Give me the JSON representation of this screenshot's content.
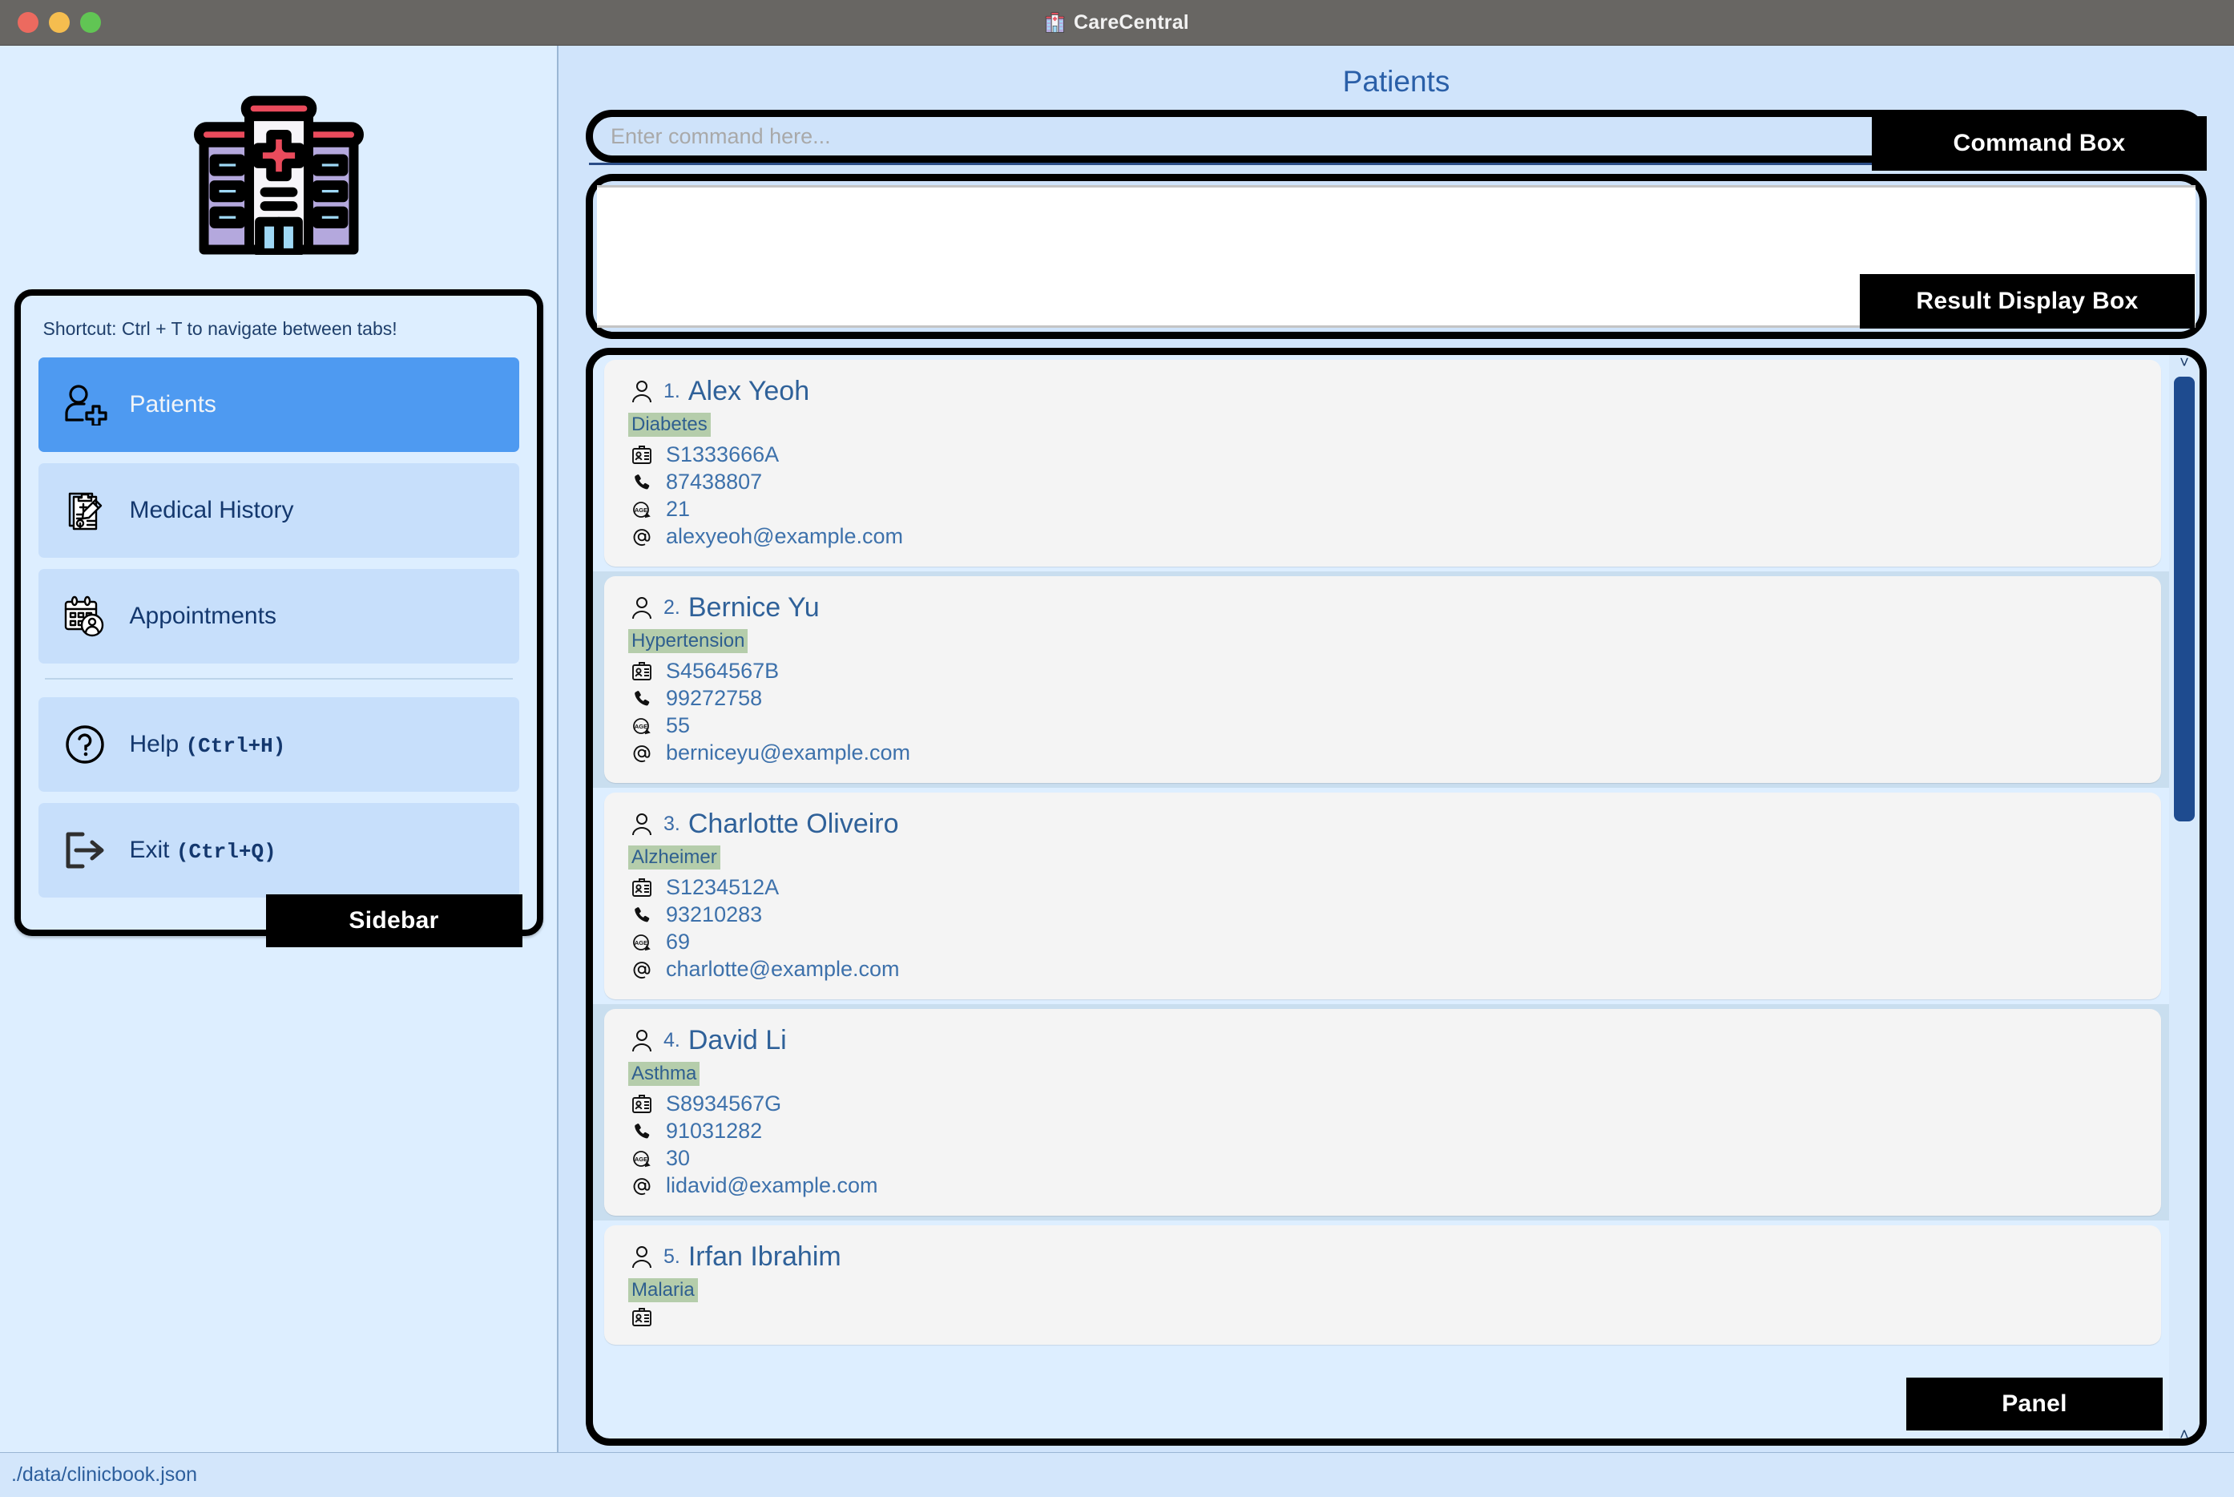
{
  "window": {
    "title": "CareCentral",
    "traffic_lights": [
      "close-red",
      "minimize-yellow",
      "maximize-green"
    ]
  },
  "sidebar": {
    "logo_icon": "hospital-building-icon",
    "shortcut_hint": "Shortcut: Ctrl + T to navigate between tabs!",
    "tag_label": "Sidebar",
    "items": [
      {
        "label": "Patients",
        "icon": "person-add-icon",
        "active": true,
        "shortcut": ""
      },
      {
        "label": "Medical History",
        "icon": "clipboard-pencil-icon",
        "active": false,
        "shortcut": ""
      },
      {
        "label": "Appointments",
        "icon": "calendar-person-icon",
        "active": false,
        "shortcut": ""
      }
    ],
    "utility_items": [
      {
        "label": "Help",
        "icon": "question-circle-icon",
        "shortcut": "(Ctrl+H)"
      },
      {
        "label": "Exit",
        "icon": "exit-arrow-icon",
        "shortcut": "(Ctrl+Q)"
      }
    ]
  },
  "main": {
    "page_title": "Patients",
    "command_tag_label": "Command Box",
    "result_tag_label": "Result Display Box",
    "panel_tag_label": "Panel",
    "command_input": {
      "value": "",
      "placeholder": "Enter command here..."
    },
    "result_display": {
      "text": ""
    },
    "scrollbar": {
      "up_arrow": "chevron-up-icon",
      "down_arrow": "chevron-down-icon",
      "thumb_position": "top"
    }
  },
  "patients": [
    {
      "index": "1.",
      "name": "Alex Yeoh",
      "tag": "Diabetes",
      "nric": "S1333666A",
      "phone": "87438807",
      "age": "21",
      "email": "alexyeoh@example.com"
    },
    {
      "index": "2.",
      "name": "Bernice Yu",
      "tag": "Hypertension",
      "nric": "S4564567B",
      "phone": "99272758",
      "age": "55",
      "email": "berniceyu@example.com"
    },
    {
      "index": "3.",
      "name": "Charlotte Oliveiro",
      "tag": "Alzheimer",
      "nric": "S1234512A",
      "phone": "93210283",
      "age": "69",
      "email": "charlotte@example.com"
    },
    {
      "index": "4.",
      "name": "David Li",
      "tag": "Asthma",
      "nric": "S8934567G",
      "phone": "91031282",
      "age": "30",
      "email": "lidavid@example.com"
    },
    {
      "index": "5.",
      "name": "Irfan Ibrahim",
      "tag": "Malaria",
      "nric": "",
      "phone": "",
      "age": "",
      "email": ""
    }
  ],
  "statusbar": {
    "file_path": "./data/clinicbook.json"
  },
  "colors": {
    "accent_blue": "#4e9af1",
    "sidebar_bg": "#ddeeff",
    "main_bg": "#d0e4fb",
    "tag_bg": "#000000",
    "tag_fg": "#ffffff",
    "condition_highlight": "#b5cdab",
    "scrollbar_thumb": "#1e4b8f",
    "titlebar_bg": "#686663"
  }
}
